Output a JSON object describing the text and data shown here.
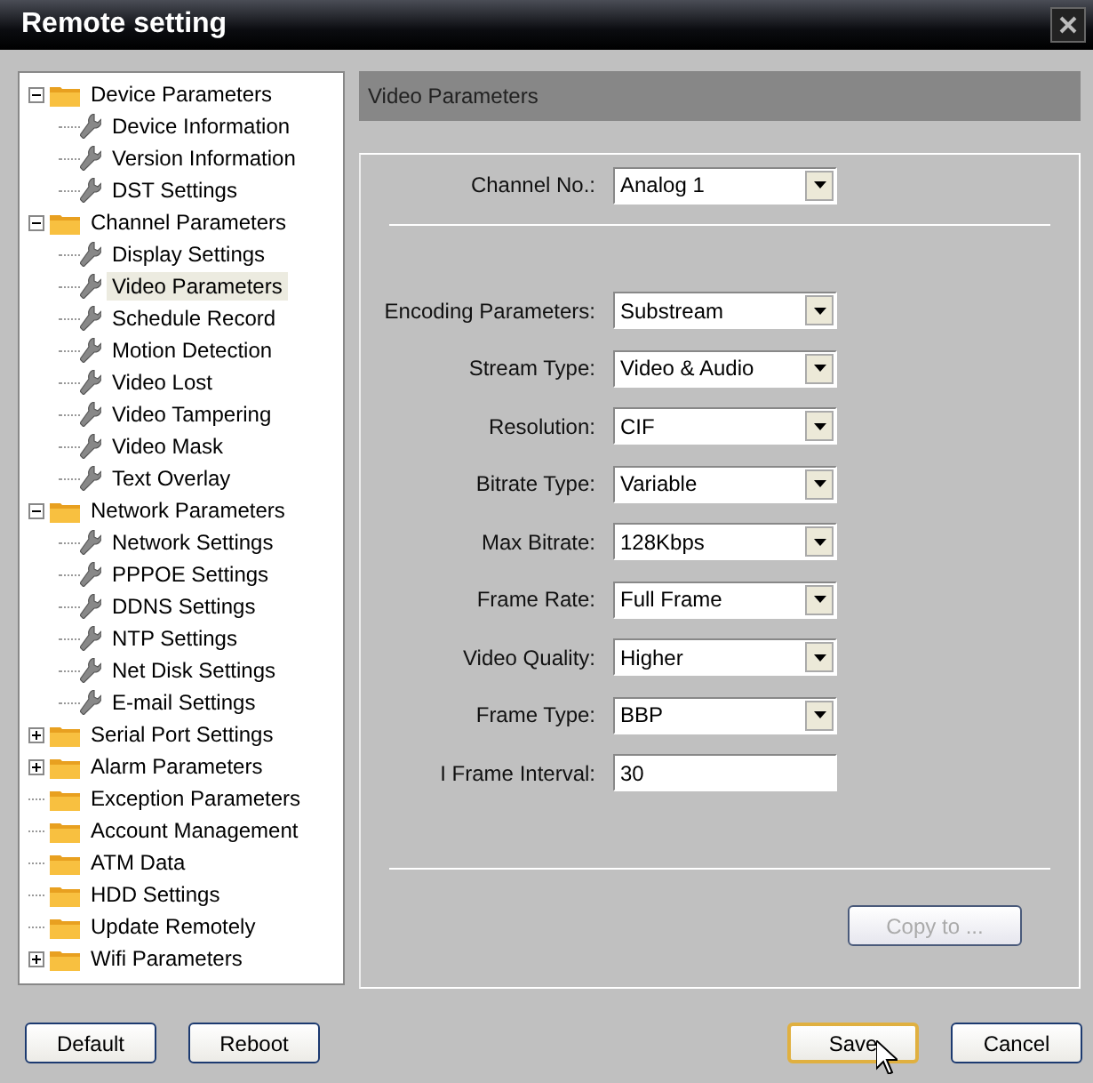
{
  "window": {
    "title": "Remote setting"
  },
  "tree": [
    {
      "label": "Device Parameters",
      "expanded": true,
      "selected": false,
      "children": [
        {
          "label": "Device Information",
          "selected": false
        },
        {
          "label": "Version Information",
          "selected": false
        },
        {
          "label": "DST Settings",
          "selected": false
        }
      ]
    },
    {
      "label": "Channel Parameters",
      "expanded": true,
      "selected": false,
      "children": [
        {
          "label": "Display Settings",
          "selected": false
        },
        {
          "label": "Video Parameters",
          "selected": true
        },
        {
          "label": "Schedule Record",
          "selected": false
        },
        {
          "label": "Motion Detection",
          "selected": false
        },
        {
          "label": "Video Lost",
          "selected": false
        },
        {
          "label": "Video Tampering",
          "selected": false
        },
        {
          "label": "Video Mask",
          "selected": false
        },
        {
          "label": "Text Overlay",
          "selected": false
        }
      ]
    },
    {
      "label": "Network Parameters",
      "expanded": true,
      "selected": false,
      "children": [
        {
          "label": "Network Settings",
          "selected": false
        },
        {
          "label": "PPPOE Settings",
          "selected": false
        },
        {
          "label": "DDNS Settings",
          "selected": false
        },
        {
          "label": "NTP Settings",
          "selected": false
        },
        {
          "label": "Net Disk Settings",
          "selected": false
        },
        {
          "label": "E-mail Settings",
          "selected": false
        }
      ]
    },
    {
      "label": "Serial Port Settings",
      "expanded": false,
      "selected": false
    },
    {
      "label": "Alarm Parameters",
      "expanded": false,
      "selected": false
    },
    {
      "label": "Exception Parameters",
      "selected": false
    },
    {
      "label": "Account Management",
      "selected": false
    },
    {
      "label": "ATM Data",
      "selected": false
    },
    {
      "label": "HDD Settings",
      "selected": false
    },
    {
      "label": "Update Remotely",
      "selected": false
    },
    {
      "label": "Wifi Parameters",
      "expanded": false,
      "selected": false
    }
  ],
  "panel": {
    "title": "Video Parameters",
    "channel": {
      "label": "Channel No.:",
      "value": "Analog 1",
      "kind": "select"
    },
    "fields": [
      {
        "label": "Encoding Parameters:",
        "value": "Substream",
        "kind": "select"
      },
      {
        "label": "Stream Type:",
        "value": "Video & Audio",
        "kind": "select"
      },
      {
        "label": "Resolution:",
        "value": "CIF",
        "kind": "select"
      },
      {
        "label": "Bitrate Type:",
        "value": "Variable",
        "kind": "select"
      },
      {
        "label": "Max Bitrate:",
        "value": "128Kbps",
        "kind": "select"
      },
      {
        "label": "Frame Rate:",
        "value": "Full Frame",
        "kind": "select"
      },
      {
        "label": "Video Quality:",
        "value": "Higher",
        "kind": "select"
      },
      {
        "label": "Frame Type:",
        "value": "BBP",
        "kind": "select"
      },
      {
        "label": "I Frame Interval:",
        "value": "30",
        "kind": "text"
      }
    ],
    "copy_button": {
      "label": "Copy to ...",
      "disabled": true
    }
  },
  "footer": {
    "left": [
      {
        "label": "Default",
        "focused": false
      },
      {
        "label": "Reboot",
        "focused": false
      }
    ],
    "right": [
      {
        "label": "Save",
        "focused": true
      },
      {
        "label": "Cancel",
        "focused": false
      }
    ]
  }
}
